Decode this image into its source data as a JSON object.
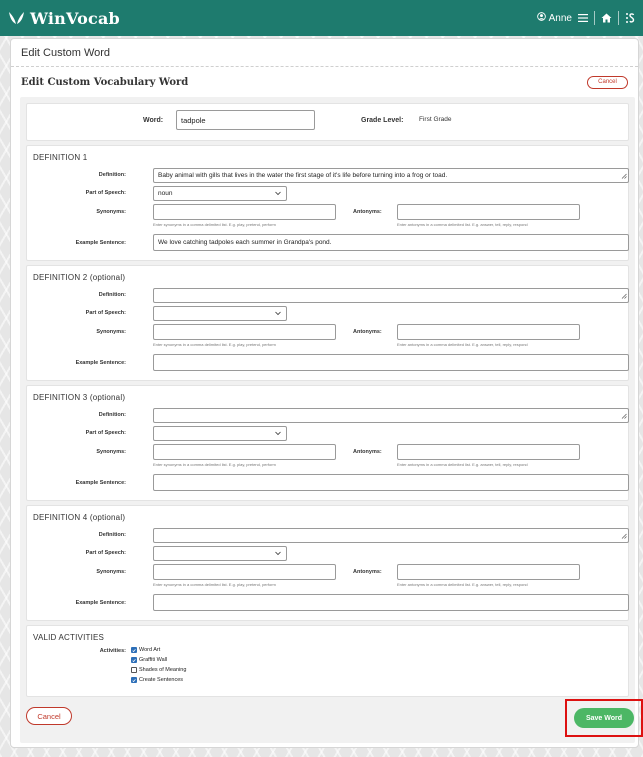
{
  "app": {
    "name": "WinVocab",
    "user": "Anne"
  },
  "page": {
    "title": "Edit Custom Word",
    "form_title": "Edit Custom Vocabulary Word",
    "cancel_label": "Cancel"
  },
  "word_section": {
    "word_label": "Word:",
    "word_value": "tadpole",
    "grade_label": "Grade Level:",
    "grade_value": "First Grade"
  },
  "labels": {
    "definition": "Definition:",
    "part_of_speech": "Part of Speech:",
    "synonyms": "Synonyms:",
    "antonyms": "Antonyms:",
    "example": "Example Sentence:",
    "syn_help": "Enter synonyms in a comma delimited list. E.g. play, pretend, perform",
    "ant_help": "Enter antonyms in a comma delimited list. E.g. answer, tell, reply, respond"
  },
  "definitions": [
    {
      "heading": "DEFINITION 1",
      "definition": "Baby animal with gills that lives in the water the first stage of it's life before turning into a frog or toad.",
      "part_of_speech": "noun",
      "synonyms": "",
      "antonyms": "",
      "example": "We love catching tadpoles each summer in Grandpa's pond."
    },
    {
      "heading": "DEFINITION 2 (optional)",
      "definition": "",
      "part_of_speech": "",
      "synonyms": "",
      "antonyms": "",
      "example": ""
    },
    {
      "heading": "DEFINITION 3 (optional)",
      "definition": "",
      "part_of_speech": "",
      "synonyms": "",
      "antonyms": "",
      "example": ""
    },
    {
      "heading": "DEFINITION 4 (optional)",
      "definition": "",
      "part_of_speech": "",
      "synonyms": "",
      "antonyms": "",
      "example": ""
    }
  ],
  "activities": {
    "heading": "VALID ACTIVITIES",
    "label": "Activities:",
    "items": [
      {
        "label": "Word Art",
        "checked": true
      },
      {
        "label": "Graffiti Wall",
        "checked": true
      },
      {
        "label": "Shades of Meaning",
        "checked": false
      },
      {
        "label": "Create Sentences",
        "checked": true
      }
    ]
  },
  "footer": {
    "cancel_label": "Cancel",
    "save_label": "Save Word"
  },
  "colors": {
    "header": "#1e7b6e",
    "save": "#4cb765",
    "cancel": "#c0392b",
    "highlight": "#dd1111",
    "checkbox": "#2d6fb8"
  },
  "icons": [
    "winvocab-logo-icon",
    "user-icon",
    "menu-icon",
    "home-icon",
    "dashboard-icon",
    "chevron-down-icon",
    "resize-icon"
  ]
}
